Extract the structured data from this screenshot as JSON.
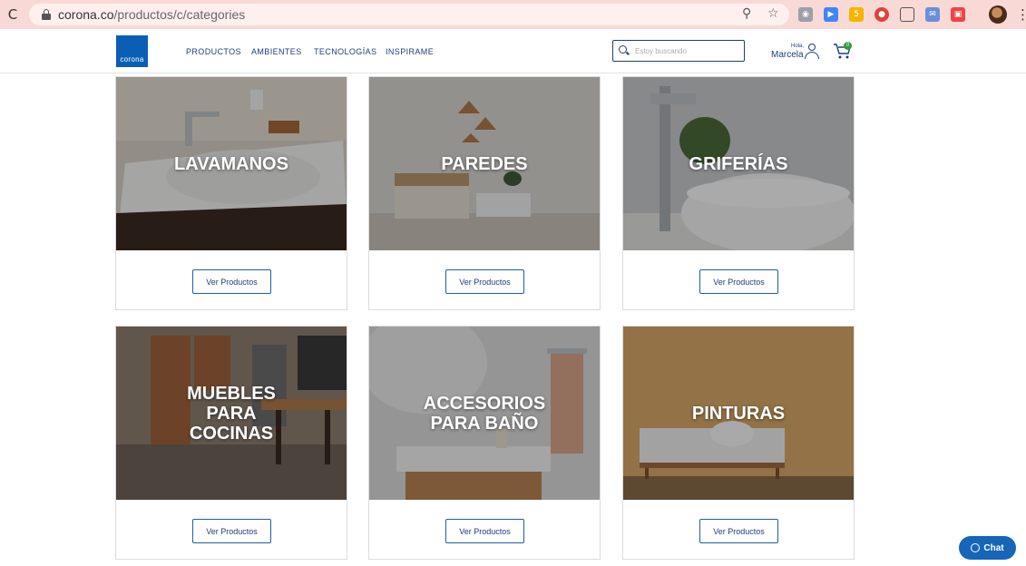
{
  "browser": {
    "url_host": "corona.co",
    "url_path": "/productos/c/categories"
  },
  "header": {
    "logo_text": "corona",
    "nav": [
      "PRODUCTOS",
      "AMBIENTES",
      "TECNOLOGÍAS",
      "INSPIRAME"
    ],
    "search_placeholder": "Estoy buscando",
    "greeting": "Hola,",
    "user_name": "Marcela",
    "cart_count": "0"
  },
  "categories": [
    {
      "title": "LAVAMANOS",
      "button": "Ver Productos"
    },
    {
      "title": "PAREDES",
      "button": "Ver Productos"
    },
    {
      "title": "GRIFERÍAS",
      "button": "Ver Productos"
    },
    {
      "title": "MUEBLES PARA COCINAS",
      "button": "Ver Productos"
    },
    {
      "title": "ACCESORIOS PARA BAÑO",
      "button": "Ver Productos"
    },
    {
      "title": "PINTURAS",
      "button": "Ver Productos"
    }
  ],
  "chat_label": "Chat",
  "colors": {
    "brand_blue": "#0a5fb4",
    "nav_text": "#1f3d7a",
    "chrome_bg": "#f8d9d6"
  }
}
